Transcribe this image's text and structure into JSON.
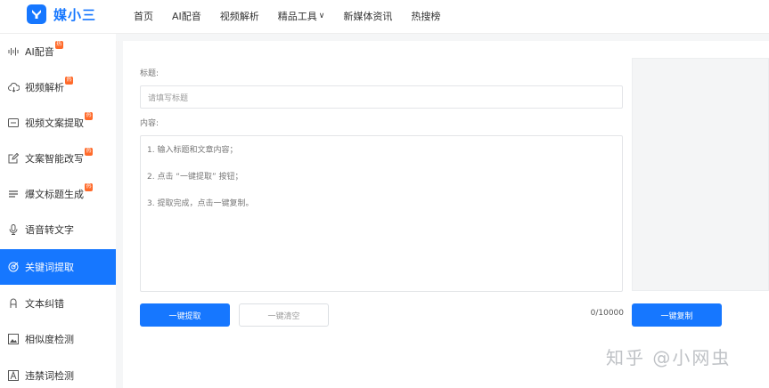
{
  "brand": {
    "name": "媒小三",
    "color": "#1677ff"
  },
  "nav": [
    {
      "label": "首页"
    },
    {
      "label": "AI配音"
    },
    {
      "label": "视频解析"
    },
    {
      "label": "精品工具",
      "chevron": "∨"
    },
    {
      "label": "新媒体资讯"
    },
    {
      "label": "热搜榜"
    }
  ],
  "sidebar": {
    "items": [
      {
        "label": "AI配音",
        "icon": "audio-wave-icon",
        "badge": "热",
        "active": false
      },
      {
        "label": "视频解析",
        "icon": "cloud-download-icon",
        "badge": "热",
        "active": false
      },
      {
        "label": "视频文案提取",
        "icon": "video-text-icon",
        "badge": "热",
        "active": false
      },
      {
        "label": "文案智能改写",
        "icon": "edit-icon",
        "badge": "热",
        "active": false
      },
      {
        "label": "爆文标题生成",
        "icon": "title-icon",
        "badge": "热",
        "active": false
      },
      {
        "label": "语音转文字",
        "icon": "microphone-icon",
        "badge": "",
        "active": false
      },
      {
        "label": "关键词提取",
        "icon": "target-icon",
        "badge": "",
        "active": true
      },
      {
        "label": "文本纠错",
        "icon": "spellcheck-icon",
        "badge": "",
        "active": false
      },
      {
        "label": "相似度检测",
        "icon": "image-compare-icon",
        "badge": "",
        "active": false
      },
      {
        "label": "违禁词检测",
        "icon": "warning-text-icon",
        "badge": "",
        "active": false
      }
    ]
  },
  "form": {
    "title_label": "标题:",
    "title_placeholder": "请填写标题",
    "content_label": "内容:",
    "content_lines": [
      "1. 输入标题和文章内容；",
      "2. 点击 “一键提取” 按钮；",
      "3. 提取完成，点击一键复制。"
    ],
    "extract_button": "一键提取",
    "clear_button": "一键清空",
    "counter": "0/10000",
    "copy_button": "一键复制"
  },
  "watermark": "知乎 @小网虫",
  "colors": {
    "accent": "#1677ff",
    "badge": "#ff6a2a"
  }
}
